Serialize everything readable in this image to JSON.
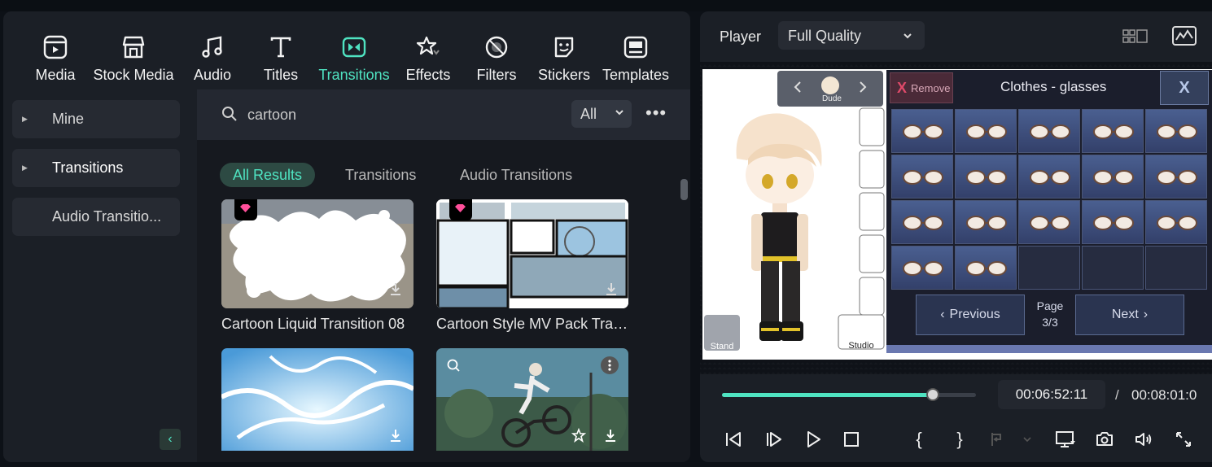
{
  "toolbar": {
    "items": [
      {
        "label": "Media",
        "icon": "media-icon"
      },
      {
        "label": "Stock Media",
        "icon": "stock-media-icon"
      },
      {
        "label": "Audio",
        "icon": "music-note-icon"
      },
      {
        "label": "Titles",
        "icon": "text-t-icon"
      },
      {
        "label": "Transitions",
        "icon": "transition-icon",
        "active": true
      },
      {
        "label": "Effects",
        "icon": "effects-icon"
      },
      {
        "label": "Filters",
        "icon": "filter-icon"
      },
      {
        "label": "Stickers",
        "icon": "sticker-icon"
      },
      {
        "label": "Templates",
        "icon": "template-icon"
      }
    ]
  },
  "sidebar": {
    "items": [
      {
        "label": "Mine",
        "has_arrow": true
      },
      {
        "label": "Transitions",
        "has_arrow": true,
        "active": true
      },
      {
        "label": "Audio Transitio...",
        "has_arrow": false
      }
    ]
  },
  "search": {
    "value": "cartoon",
    "filter_value": "All"
  },
  "filter_tabs": [
    {
      "label": "All Results",
      "active": true
    },
    {
      "label": "Transitions"
    },
    {
      "label": "Audio Transitions"
    }
  ],
  "results": [
    {
      "title": "Cartoon Liquid Transition 08",
      "premium": true
    },
    {
      "title": "Cartoon Style MV Pack Trans...",
      "premium": true
    },
    {
      "title": "",
      "premium": false
    },
    {
      "title": "",
      "premium": false
    }
  ],
  "player": {
    "label": "Player",
    "quality": "Full Quality",
    "current_time": "00:06:52:11",
    "separator": "/",
    "total_time": "00:08:01:0",
    "progress": 0.83
  },
  "game": {
    "character_name": "Dude",
    "remove_label": "Remove",
    "remove_x": "X",
    "category_title": "Clothes - glasses",
    "close_label": "X",
    "previous_label": "Previous",
    "next_label": "Next",
    "page_label": "Page",
    "page_value": "3/3",
    "stand_label": "Stand",
    "studio_label": "Studio"
  },
  "colors": {
    "accent": "#4fe3c1",
    "premium": "#ff4f9a"
  }
}
